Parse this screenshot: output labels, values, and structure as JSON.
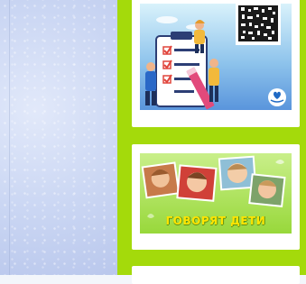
{
  "sidebar": {
    "accent_color": "#a4da0b",
    "cards": [
      {
        "name": "survey-qr-card",
        "icons": [
          "checklist-icon",
          "qr-code-icon",
          "heart-hand-logo-icon"
        ]
      },
      {
        "name": "children-speak-card",
        "title": "ГОВОРЯТ ДЕТИ"
      },
      {
        "name": "partial-card"
      }
    ]
  }
}
